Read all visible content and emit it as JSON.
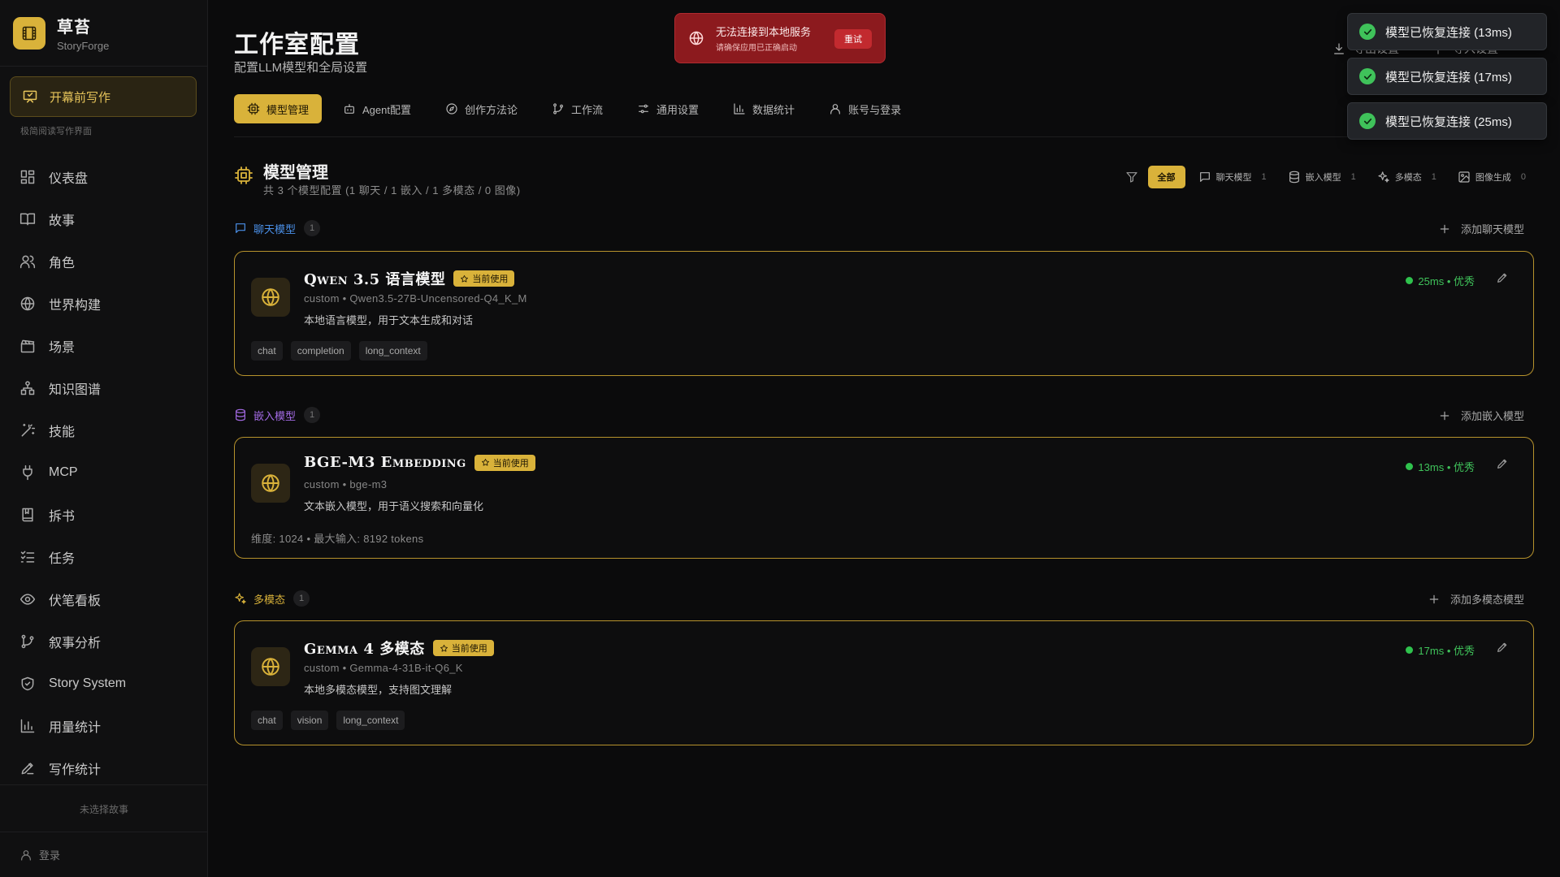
{
  "app": {
    "name": "草苔",
    "sub": "StoryForge"
  },
  "sidebar": {
    "write_button": "开幕前写作",
    "write_hint": "极简阅读写作界面",
    "items": [
      {
        "label": "仪表盘",
        "icon": "dashboard-icon"
      },
      {
        "label": "故事",
        "icon": "book-icon"
      },
      {
        "label": "角色",
        "icon": "users-icon"
      },
      {
        "label": "世界构建",
        "icon": "globe-icon"
      },
      {
        "label": "场景",
        "icon": "clapperboard-icon"
      },
      {
        "label": "知识图谱",
        "icon": "network-icon"
      },
      {
        "label": "技能",
        "icon": "wand-icon"
      },
      {
        "label": "MCP",
        "icon": "plug-icon"
      },
      {
        "label": "拆书",
        "icon": "bookmark-book-icon"
      },
      {
        "label": "任务",
        "icon": "list-check-icon"
      },
      {
        "label": "伏笔看板",
        "icon": "eye-icon"
      },
      {
        "label": "叙事分析",
        "icon": "git-branch-icon"
      },
      {
        "label": "Story System",
        "icon": "shield-icon"
      },
      {
        "label": "用量统计",
        "icon": "bar-chart-icon"
      },
      {
        "label": "写作统计",
        "icon": "pen-icon"
      }
    ],
    "no_story": "未选择故事",
    "login": "登录"
  },
  "header": {
    "title": "工作室配置",
    "subtitle": "配置LLM模型和全局设置",
    "export": "导出设置",
    "import": "导入设置"
  },
  "tabs": [
    {
      "label": "模型管理",
      "icon": "cpu-icon",
      "active": true
    },
    {
      "label": "Agent配置",
      "icon": "bot-icon",
      "active": false
    },
    {
      "label": "创作方法论",
      "icon": "compass-icon",
      "active": false
    },
    {
      "label": "工作流",
      "icon": "git-branch-icon",
      "active": false
    },
    {
      "label": "通用设置",
      "icon": "sliders-icon",
      "active": false
    },
    {
      "label": "数据统计",
      "icon": "bar-chart-icon",
      "active": false
    },
    {
      "label": "账号与登录",
      "icon": "user-icon",
      "active": false
    }
  ],
  "section": {
    "title": "模型管理",
    "subtitle": "共 3 个模型配置 (1 聊天 / 1 嵌入 / 1 多模态 / 0 图像)"
  },
  "filters": {
    "all": "全部",
    "chips": [
      {
        "label": "聊天模型",
        "count": "1"
      },
      {
        "label": "嵌入模型",
        "count": "1"
      },
      {
        "label": "多模态",
        "count": "1"
      },
      {
        "label": "图像生成",
        "count": "0"
      }
    ]
  },
  "groups": [
    {
      "label": "聊天模型",
      "count": "1",
      "add": "添加聊天模型",
      "color": "#4a8fe7",
      "card": {
        "name": "Qwen 3.5 语言模型",
        "badge": "当前使用",
        "model": "custom • Qwen3.5-27B-Uncensored-Q4_K_M",
        "desc": "本地语言模型，用于文本生成和对话",
        "tags": [
          "chat",
          "completion",
          "long_context"
        ],
        "status": "25ms • 优秀"
      }
    },
    {
      "label": "嵌入模型",
      "count": "1",
      "add": "添加嵌入模型",
      "color": "#a46be6",
      "card": {
        "name": "BGE-M3 Embedding",
        "badge": "当前使用",
        "model": "custom • bge-m3",
        "desc": "文本嵌入模型，用于语义搜索和向量化",
        "extra": "维度: 1024 • 最大输入: 8192 tokens",
        "status": "13ms • 优秀"
      }
    },
    {
      "label": "多模态",
      "count": "1",
      "add": "添加多模态模型",
      "color": "#d9b23a",
      "card": {
        "name": "Gemma 4 多模态",
        "badge": "当前使用",
        "model": "custom • Gemma-4-31B-it-Q6_K",
        "desc": "本地多模态模型，支持图文理解",
        "tags": [
          "chat",
          "vision",
          "long_context"
        ],
        "status": "17ms • 优秀"
      }
    }
  ],
  "error_toast": {
    "title": "无法连接到本地服务",
    "sub": "请确保应用已正确启动",
    "retry": "重试"
  },
  "success_toasts": [
    "模型已恢复连接 (13ms)",
    "模型已恢复连接 (17ms)",
    "模型已恢复连接 (25ms)"
  ],
  "colors": {
    "accent": "#d9b23a",
    "success": "#3fc25a",
    "error": "#8c1a1e"
  }
}
